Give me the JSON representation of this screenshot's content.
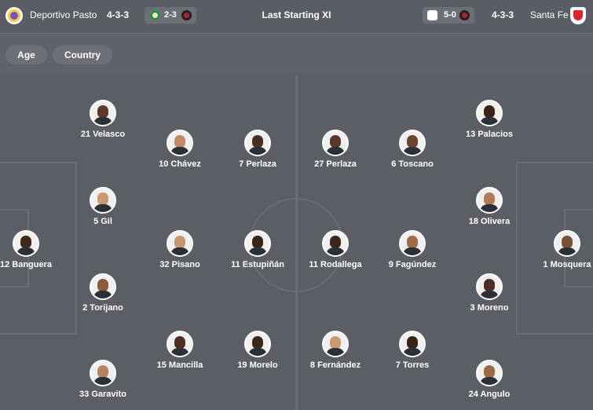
{
  "header": {
    "home_team": "Deportivo Pasto",
    "home_formation": "4-3-3",
    "home_last_score": "2-3",
    "title": "Last Starting XI",
    "away_last_score": "5-0",
    "away_formation": "4-3-3",
    "away_team": "Santa Fe"
  },
  "filters": {
    "age": "Age",
    "country": "Country"
  },
  "colors": {
    "pasto_primary": "#7a4fc3",
    "pasto_secondary": "#f2cf3a",
    "santafe_primary": "#d7262e"
  },
  "home_players": [
    {
      "label": "21 Velasco"
    },
    {
      "label": "10 Chávez"
    },
    {
      "label": "7 Perlaza"
    },
    {
      "label": "5 Gil"
    },
    {
      "label": "12 Banguera"
    },
    {
      "label": "32 Pisano"
    },
    {
      "label": "11 Estupiñán"
    },
    {
      "label": "2 Torijano"
    },
    {
      "label": "15 Mancilla"
    },
    {
      "label": "19 Morelo"
    },
    {
      "label": "33 Garavito"
    }
  ],
  "away_players": [
    {
      "label": "27 Perlaza"
    },
    {
      "label": "6 Toscano"
    },
    {
      "label": "13 Palacios"
    },
    {
      "label": "18 Olivera"
    },
    {
      "label": "1 Mosquera"
    },
    {
      "label": "11 Rodallega"
    },
    {
      "label": "9 Fagúndez"
    },
    {
      "label": "3 Moreno"
    },
    {
      "label": "8 Fernández"
    },
    {
      "label": "7 Torres"
    },
    {
      "label": "24 Angulo"
    }
  ]
}
